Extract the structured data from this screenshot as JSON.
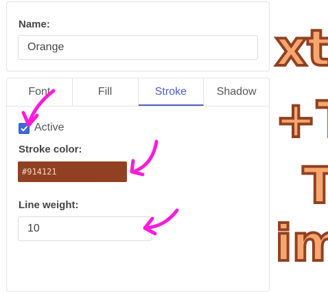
{
  "name_panel": {
    "label": "Name:",
    "value": "Orange"
  },
  "tabs": [
    {
      "label": "Font"
    },
    {
      "label": "Fill"
    },
    {
      "label": "Stroke"
    },
    {
      "label": "Shadow"
    }
  ],
  "stroke": {
    "active_label": "Active",
    "active_checked": true,
    "color_label": "Stroke color:",
    "color_value": "#914121",
    "line_weight_label": "Line weight:",
    "line_weight_value": "10"
  },
  "background_preview": {
    "text_color": "#f6a66f",
    "stroke_color": "#914121",
    "lines": [
      "xt",
      "+T",
      "T",
      "im"
    ]
  },
  "annotation_color": "#ff1ad9"
}
